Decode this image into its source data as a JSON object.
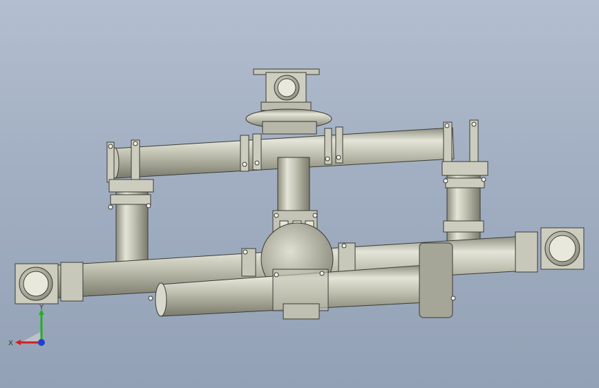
{
  "viewport": {
    "background_top": "#b3bfd0",
    "background_bottom": "#93a1b6",
    "model_fill": "#b8b8a8",
    "model_fill_light": "#d6d6c8",
    "model_stroke": "#3a3a34"
  },
  "triad": {
    "x_label": "X",
    "y_label": "Y",
    "x_color": "#d02020",
    "y_color": "#20b020",
    "z_color": "#2040d0"
  }
}
